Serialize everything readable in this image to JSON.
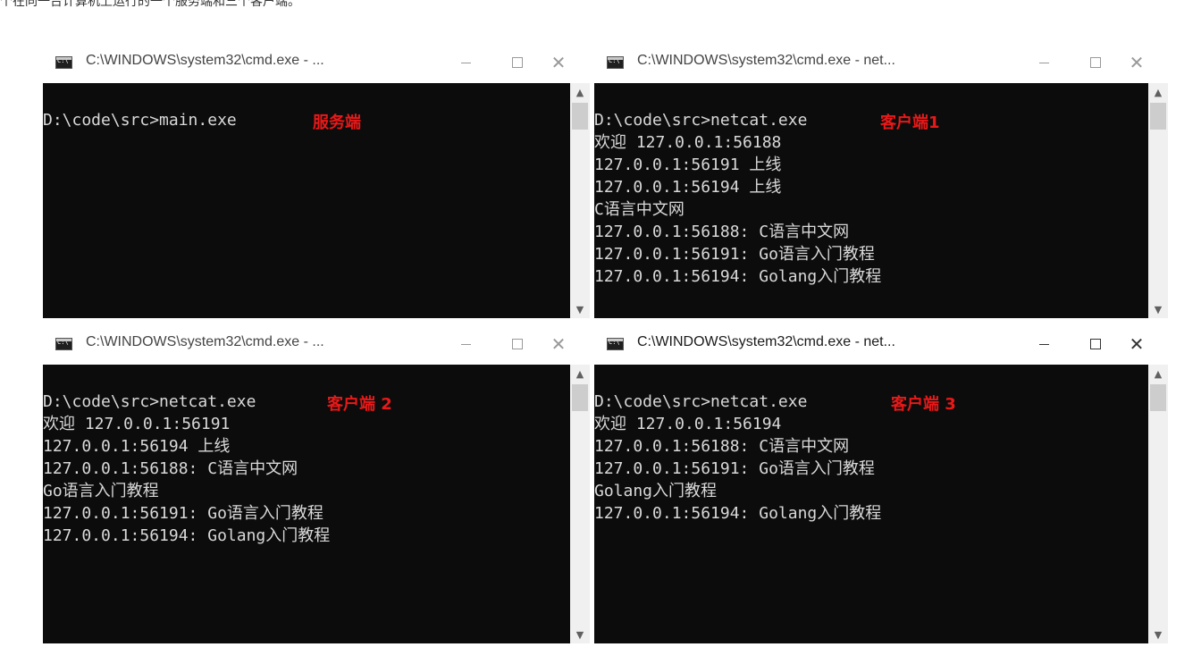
{
  "caption": "个在同一台计算机上运行的一个服务端和三个客户端。",
  "window_title_short": "C:\\WINDOWS\\system32\\cmd.exe - ...",
  "window_title_long": "C:\\WINDOWS\\system32\\cmd.exe - net...",
  "controls": {
    "minimize": "—",
    "maximize": "☐",
    "close": "✕"
  },
  "icons": {
    "console_icon": "cmd-icon",
    "scroll_up": "▲",
    "scroll_down": "▼"
  },
  "windows": [
    {
      "id": "server",
      "state": "inactive",
      "label": "服务端",
      "lines": [
        "D:\\code\\src>main.exe"
      ]
    },
    {
      "id": "client1",
      "state": "inactive",
      "label": "客户端1",
      "lines": [
        "D:\\code\\src>netcat.exe",
        "欢迎 127.0.0.1:56188",
        "127.0.0.1:56191 上线",
        "127.0.0.1:56194 上线",
        "C语言中文网",
        "127.0.0.1:56188: C语言中文网",
        "127.0.0.1:56191: Go语言入门教程",
        "127.0.0.1:56194: Golang入门教程"
      ]
    },
    {
      "id": "client2",
      "state": "inactive",
      "label": "客户端 2",
      "lines": [
        "D:\\code\\src>netcat.exe",
        "欢迎 127.0.0.1:56191",
        "127.0.0.1:56194 上线",
        "127.0.0.1:56188: C语言中文网",
        "Go语言入门教程",
        "127.0.0.1:56191: Go语言入门教程",
        "127.0.0.1:56194: Golang入门教程"
      ]
    },
    {
      "id": "client3",
      "state": "active",
      "label": "客户端 3",
      "lines": [
        "D:\\code\\src>netcat.exe",
        "欢迎 127.0.0.1:56194",
        "127.0.0.1:56188: C语言中文网",
        "127.0.0.1:56191: Go语言入门教程",
        "Golang入门教程",
        "127.0.0.1:56194: Golang入门教程"
      ]
    }
  ],
  "colors": {
    "console_bg": "#0c0c0c",
    "console_text": "#d9d9d9",
    "label_red": "#e81919"
  }
}
